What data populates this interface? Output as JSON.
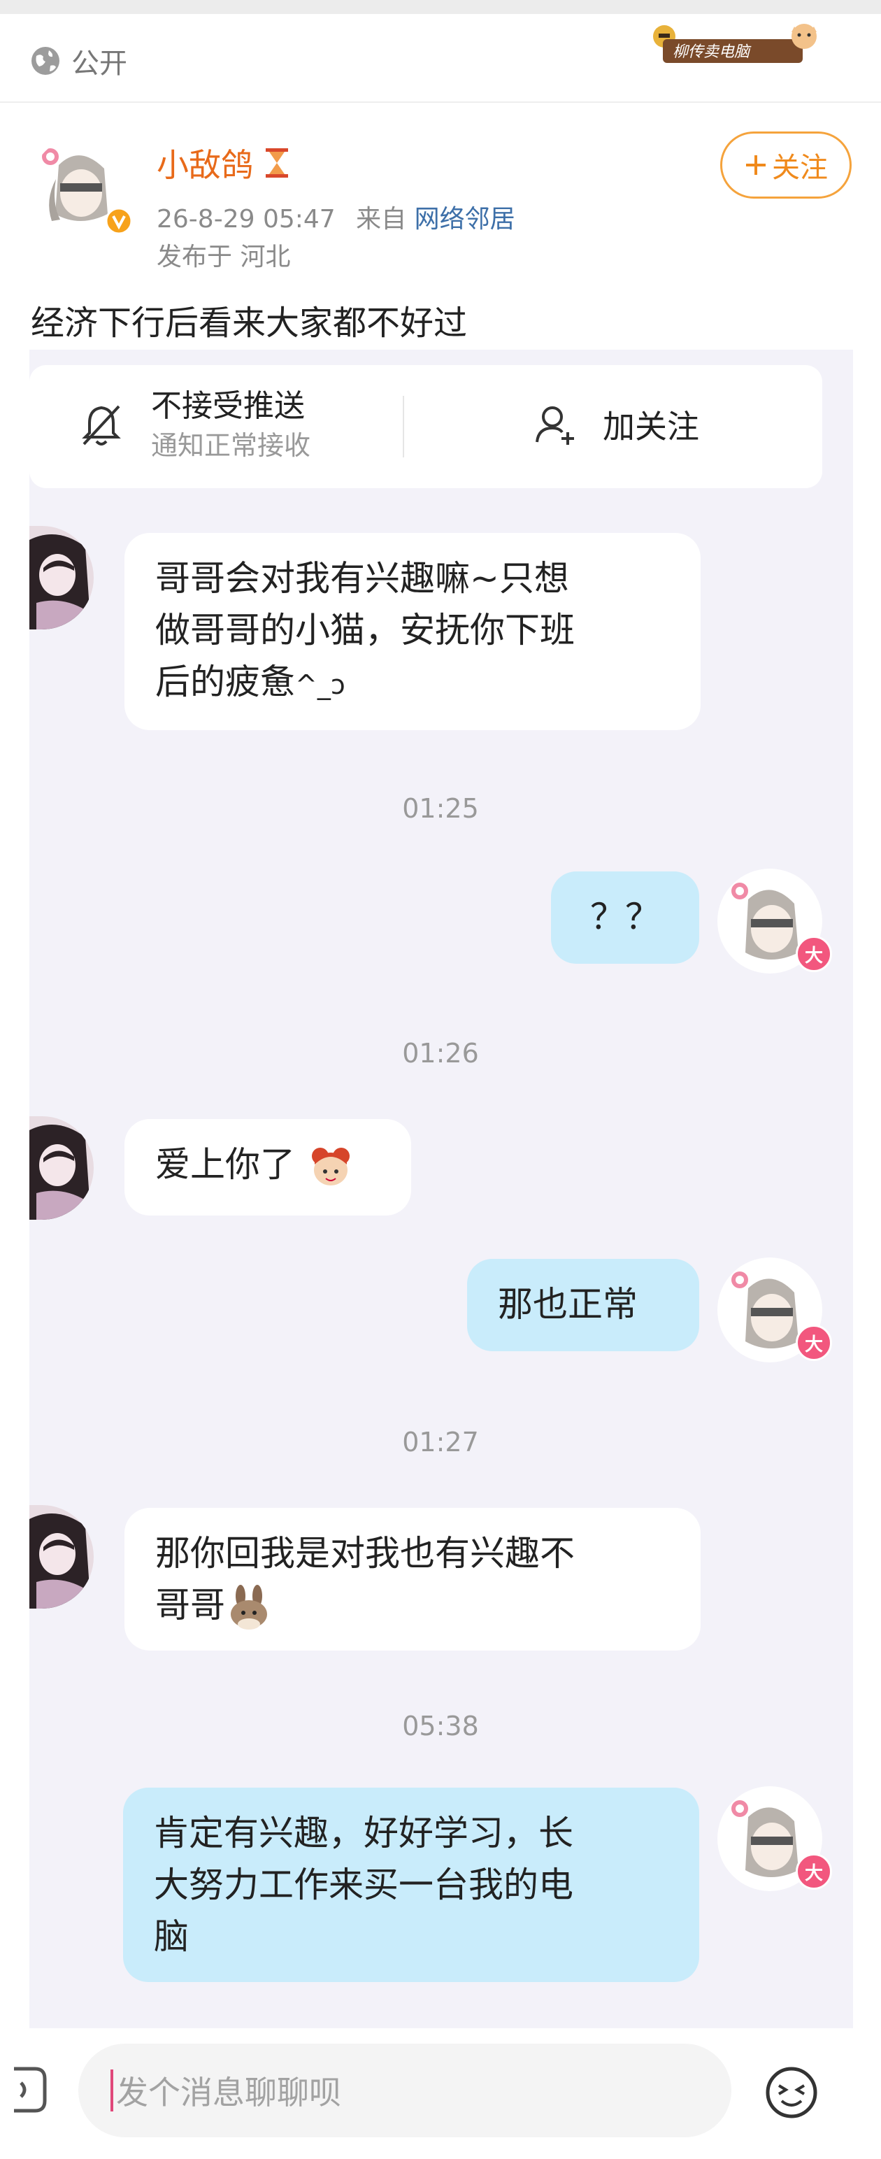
{
  "header": {
    "visibility_label": "公开",
    "watermark_text": "柳传卖电脑"
  },
  "post": {
    "author": "小敌鸽",
    "time": "26-8-29 05:47",
    "source_prefix": "来自",
    "source": "网络邻居",
    "location": "发布于 河北",
    "follow_label": "关注",
    "text": "经济下行后看来大家都不好过"
  },
  "notice": {
    "no_push_title": "不接受推送",
    "no_push_sub": "通知正常接收",
    "follow_label": "加关注"
  },
  "chat": {
    "msg1": [
      "哥哥会对我有兴趣嘛~只想",
      "做哥哥的小猫，安抚你下班",
      "后的疲惫"
    ],
    "ts1": "01:25",
    "msg2": "？？",
    "ts2": "01:26",
    "msg3": "爱上你了",
    "msg4": "那也正常",
    "ts3": "01:27",
    "msg5": [
      "那你回我是对我也有兴趣不",
      "哥哥"
    ],
    "ts4": "05:38",
    "msg6": [
      "肯定有兴趣，好好学习，长",
      "大努力工作来买一台我的电",
      "脑"
    ],
    "badge": "大"
  },
  "input": {
    "placeholder": "发个消息聊聊呗"
  },
  "colors": {
    "name_orange": "#e86a1a",
    "follow_border": "#f5a33c",
    "link_blue": "#3d6fa8",
    "out_bubble": "#c9ecfb",
    "chat_bg": "#f3f2f9",
    "badge_pink": "#f2577e"
  },
  "icons": [
    "globe-icon",
    "hourglass-icon",
    "verified-icon",
    "bell-off-icon",
    "add-user-icon",
    "emoji-icon",
    "voice-icon"
  ]
}
